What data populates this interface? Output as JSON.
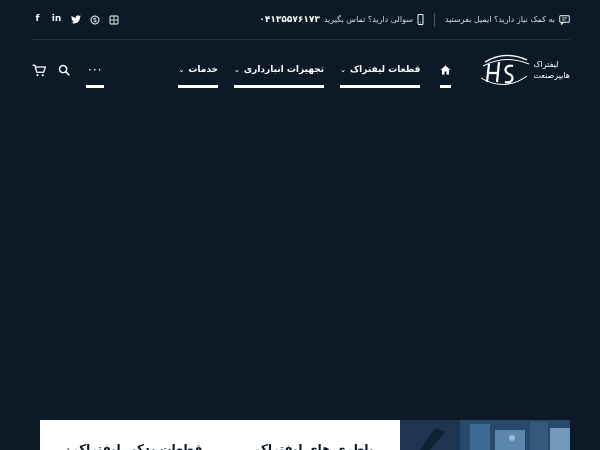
{
  "topbar": {
    "email_text": "به کمک نیاز دارید؟ ایمیل بفرستید",
    "phone_prompt": "سوالی دارید؟ تماس بگیرید",
    "phone_number": "۰۴۱۳۵۵۷۶۱۷۳",
    "social_icons": [
      "facebook-icon",
      "linkedin-icon",
      "twitter-icon",
      "skype-icon",
      "windows-icon"
    ]
  },
  "nav": {
    "home_icon": "home-icon",
    "items": [
      {
        "label": "قطعات لیفتراک"
      },
      {
        "label": "تجهیزات انبارداری"
      },
      {
        "label": "خدمات"
      }
    ],
    "more": "···",
    "search_icon": "search-icon",
    "cart_icon": "cart-icon"
  },
  "logo": {
    "line1": "لیفتراک",
    "line2": "هایپرصنعت"
  },
  "hero": {
    "card_items": [
      {
        "label": "قطعات یدکی لیفتراک"
      },
      {
        "label": "باطری های لیفتراک"
      }
    ]
  },
  "colors": {
    "background": "#0b1a26",
    "text": "#ffffff",
    "card": "#ffffff"
  }
}
